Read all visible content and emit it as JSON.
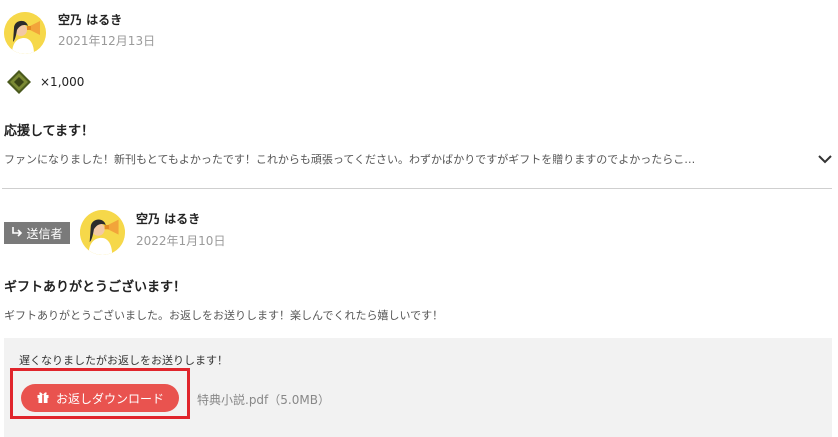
{
  "gift_post": {
    "user_name": "空乃 はるき",
    "date": "2021年12月13日",
    "gift_icon": "gift-gem-icon",
    "gift_quantity": "×1,000",
    "title": "応援してます！",
    "message": "ファンになりました！新刊もとてもよかったです！これからも頑張ってください。わずかばかりですがギフトを贈りますのでよかったらこ…",
    "expand_icon": "chevron-down-icon"
  },
  "reply_post": {
    "badge_icon": "reply-arrow-icon",
    "badge_label": "送信者",
    "user_name": "空乃 はるき",
    "date": "2022年1月10日",
    "title": "ギフトありがとうございます！",
    "message": "ギフトありがとうございました。お返しをお送りします！楽しんでくれたら嬉しいです！",
    "return_gift": {
      "message": "遅くなりましたがお返しをお送りします！",
      "download_icon": "gift-box-icon",
      "download_label": "お返しダウンロード",
      "file_info": "特典小説.pdf（5.0MB）"
    }
  },
  "colors": {
    "accent": "#e9534f",
    "highlight_frame": "#e0252c",
    "badge": "#7a7a7a",
    "avatar_bg": "#f6d84a"
  }
}
